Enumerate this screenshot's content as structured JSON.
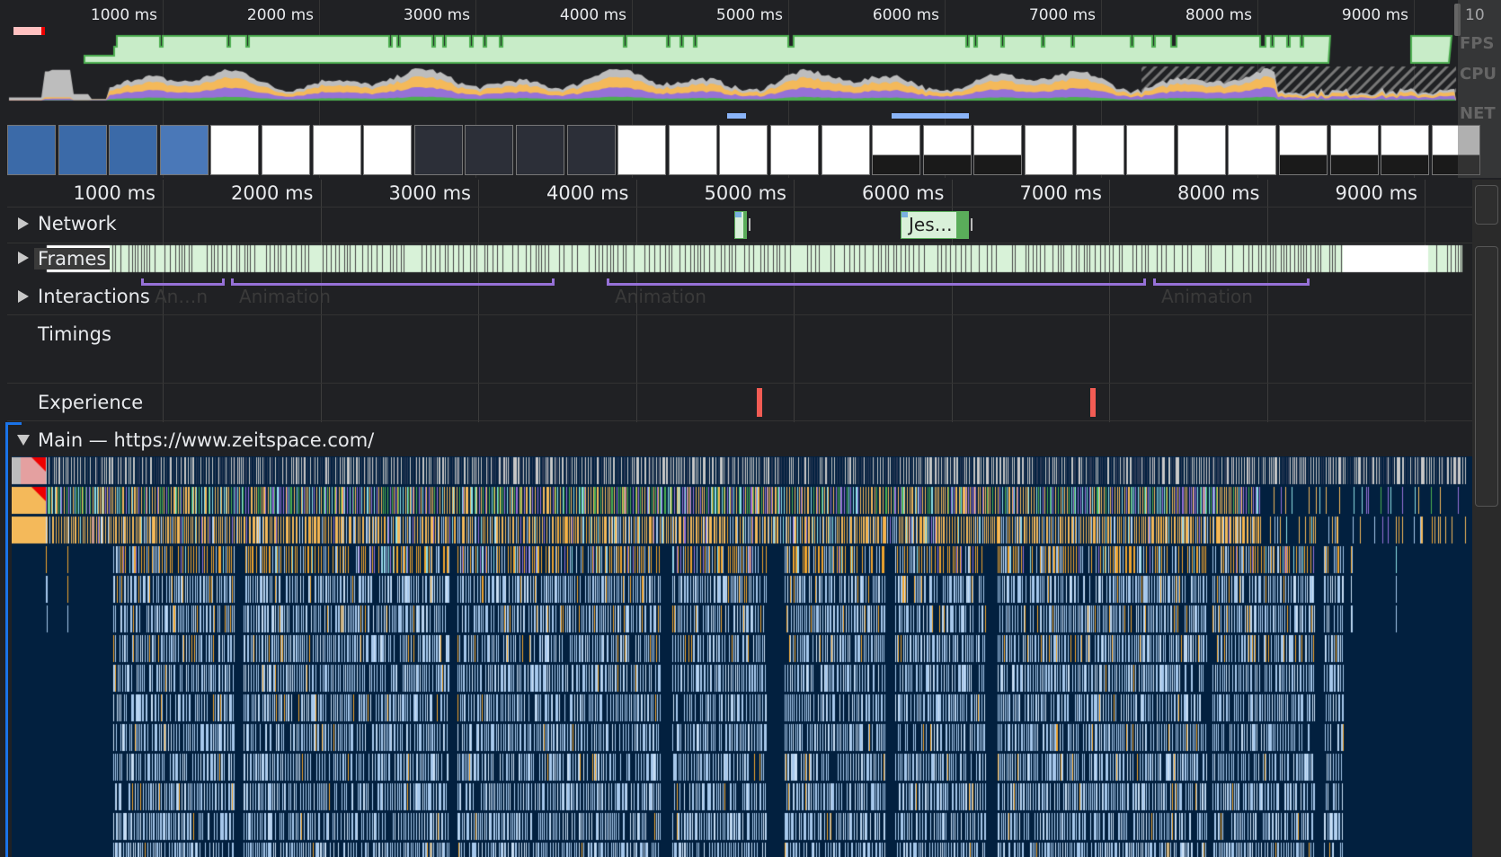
{
  "overview": {
    "ticks": [
      "1000 ms",
      "2000 ms",
      "3000 ms",
      "4000 ms",
      "5000 ms",
      "6000 ms",
      "7000 ms",
      "8000 ms",
      "9000 ms",
      "10"
    ],
    "lanes": {
      "fps": "FPS",
      "cpu": "CPU",
      "net": "NET"
    }
  },
  "ruler": {
    "ticks": [
      "1000 ms",
      "2000 ms",
      "3000 ms",
      "4000 ms",
      "5000 ms",
      "6000 ms",
      "7000 ms",
      "8000 ms",
      "9000 ms"
    ]
  },
  "tracks": {
    "network": "Network",
    "frames": "Frames",
    "interactions": "Interactions",
    "timings": "Timings",
    "experience": "Experience",
    "main": "Main — https://www.zeitspace.com/"
  },
  "network_items": [
    {
      "label": ""
    },
    {
      "label": "Jes…"
    }
  ],
  "interactions": [
    {
      "label": "An…n"
    },
    {
      "label": "Animation"
    },
    {
      "label": "Animation"
    },
    {
      "label": "Animation"
    }
  ],
  "colors": {
    "fps": "#c8ecc8",
    "fps_line": "#4caf50",
    "scripting": "#f4b95a",
    "rendering": "#9671d7",
    "painting": "#4caf50",
    "system": "#bdbdbd",
    "flame_bg": "#02203f",
    "flame_js": "#a6c8ec",
    "layout_shift": "#f25c54",
    "interaction": "#9671d7"
  }
}
